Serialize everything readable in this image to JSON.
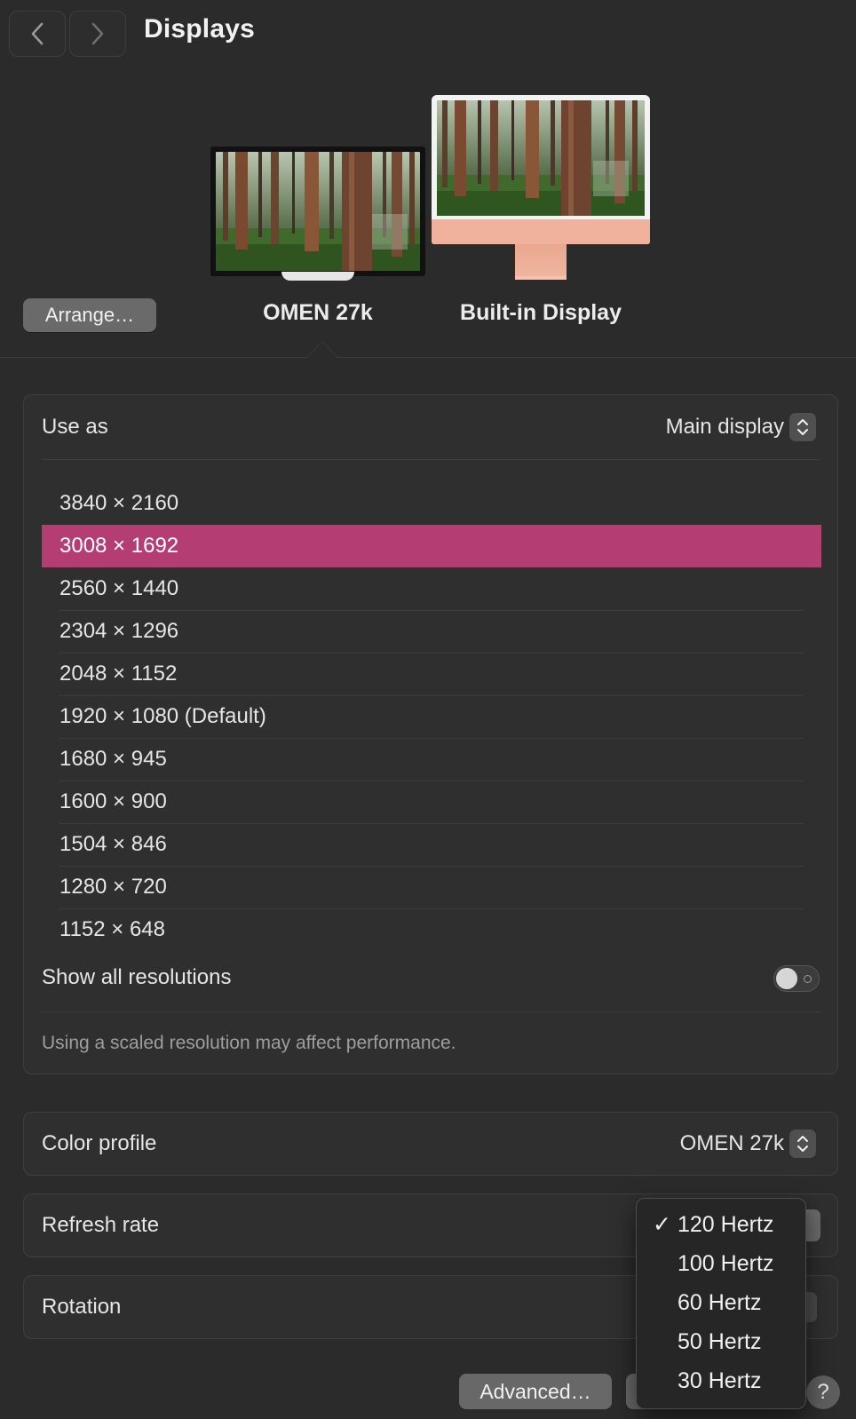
{
  "header": {
    "title": "Displays",
    "back_icon": "chevron-left-icon",
    "forward_icon": "chevron-right-icon"
  },
  "displays": {
    "arrange_label": "Arrange…",
    "items": [
      {
        "name": "OMEN 27k",
        "selected": true
      },
      {
        "name": "Built-in Display",
        "selected": false
      }
    ]
  },
  "use_as": {
    "label": "Use as",
    "value": "Main display"
  },
  "resolutions": {
    "items": [
      "3840 × 2160",
      "3008 × 1692",
      "2560 × 1440",
      "2304 × 1296",
      "2048 × 1152",
      "1920 × 1080 (Default)",
      "1680 × 945",
      "1600 × 900",
      "1504 × 846",
      "1280 × 720",
      "1152 × 648"
    ],
    "selected": "3008 × 1692",
    "show_all_label": "Show all resolutions",
    "show_all_on": false,
    "note": "Using a scaled resolution may affect performance."
  },
  "color_profile": {
    "label": "Color profile",
    "value": "OMEN 27k"
  },
  "refresh_rate": {
    "label": "Refresh rate",
    "options": [
      "120 Hertz",
      "100 Hertz",
      "60 Hertz",
      "50 Hertz",
      "30 Hertz"
    ],
    "selected": "120 Hertz",
    "check_mark": "✓"
  },
  "rotation": {
    "label": "Rotation"
  },
  "footer": {
    "advanced_label": "Advanced…",
    "help_label": "?"
  },
  "colors": {
    "background": "#2b2b2b",
    "selection": "#b43d73",
    "imac_accent": "#f0b29c"
  }
}
